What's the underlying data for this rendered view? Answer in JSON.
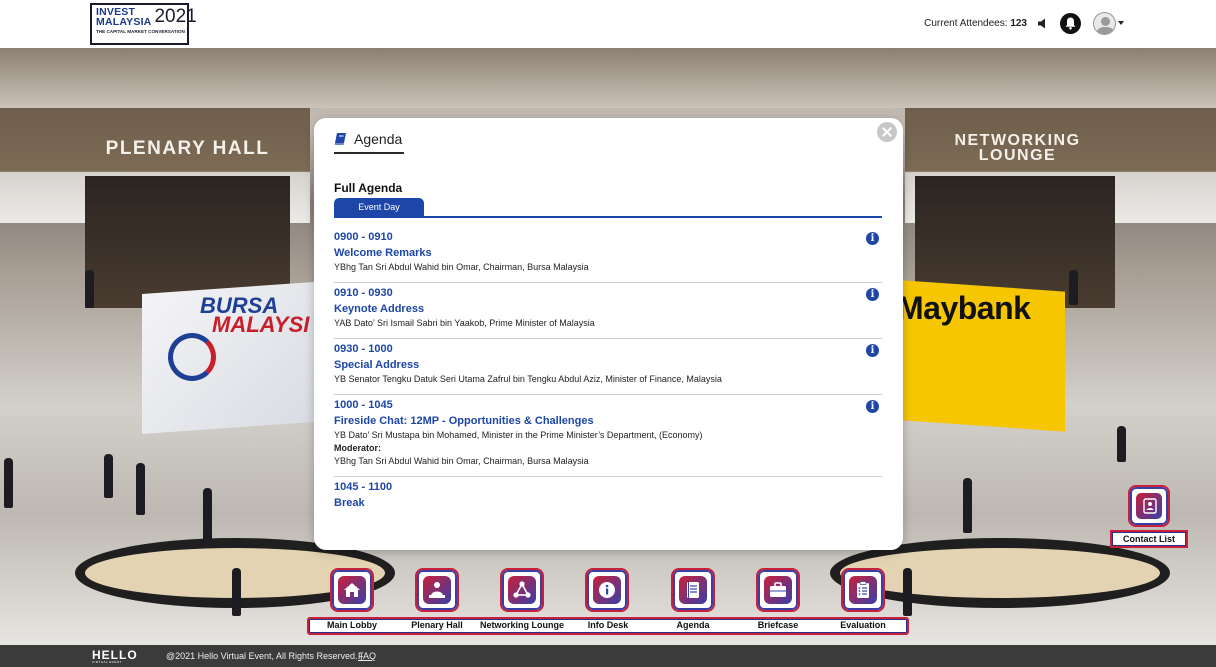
{
  "header": {
    "logo": {
      "line1": "INVEST",
      "line2": "MALAYSIA",
      "year": "2021",
      "tagline": "THE CAPITAL MARKET CONVERSATION"
    },
    "attendees_label": "Current Attendees:",
    "attendees_count": "123"
  },
  "scene": {
    "left_hall_sign": "PLENARY HALL",
    "right_hall_sign_line1": "NETWORKING",
    "right_hall_sign_line2": "LOUNGE",
    "bursa_line1": "BURSA",
    "bursa_line2": "MALAYSI",
    "maybank": "Maybank"
  },
  "modal": {
    "title": "Agenda",
    "section_heading": "Full Agenda",
    "tabs": [
      {
        "label": "Event Day",
        "active": true
      }
    ],
    "items": [
      {
        "time": "0900 - 0910",
        "title": "Welcome Remarks",
        "speaker": "YBhg Tan Sri Abdul Wahid bin Omar, Chairman, Bursa Malaysia"
      },
      {
        "time": "0910 - 0930",
        "title": "Keynote Address",
        "speaker": "YAB Dato’ Sri Ismail Sabri bin Yaakob, Prime Minister of Malaysia"
      },
      {
        "time": "0930 - 1000",
        "title": "Special Address",
        "speaker": "YB Senator Tengku Datuk Seri Utama Zafrul bin Tengku Abdul Aziz, Minister of Finance, Malaysia"
      },
      {
        "time": "1000 - 1045",
        "title": "Fireside Chat: 12MP - Opportunities & Challenges",
        "speaker": "YB Dato’ Sri Mustapa bin Mohamed, Minister in the Prime Minister’s Department, (Economy)",
        "moderator_label": "Moderator:",
        "moderator": "YBhg Tan Sri Abdul Wahid bin Omar, Chairman, Bursa Malaysia"
      },
      {
        "time": "1045 - 1100",
        "title": "Break"
      }
    ],
    "info_glyph": "i"
  },
  "contact_list": {
    "label": "Contact List"
  },
  "nav": [
    {
      "label": "Main Lobby",
      "icon": "home-icon"
    },
    {
      "label": "Plenary Hall",
      "icon": "presenter-icon"
    },
    {
      "label": "Networking Lounge",
      "icon": "network-icon"
    },
    {
      "label": "Info Desk",
      "icon": "info-icon"
    },
    {
      "label": "Agenda",
      "icon": "notebook-icon"
    },
    {
      "label": "Briefcase",
      "icon": "briefcase-icon"
    },
    {
      "label": "Evaluation",
      "icon": "clipboard-icon"
    }
  ],
  "footer": {
    "brand": "HELLO",
    "brand_sub": "VIRTUAL EVENT",
    "copyright": "@2021 Hello Virtual Event, All Rights Reserved. |",
    "faq": "FAQ"
  },
  "colors": {
    "accent_blue": "#1d46a8",
    "accent_red": "#c8203a",
    "footer_bg": "#3b3b3b"
  }
}
